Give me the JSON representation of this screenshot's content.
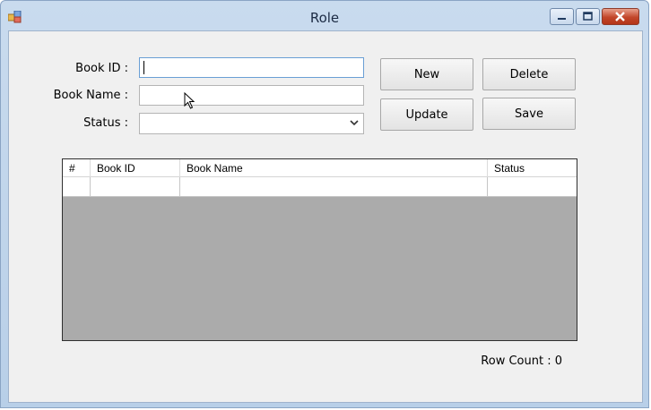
{
  "window": {
    "title": "Role"
  },
  "form": {
    "book_id_label": "Book ID :",
    "book_id_value": "",
    "book_name_label": "Book Name :",
    "book_name_value": "",
    "status_label": "Status :",
    "status_value": ""
  },
  "buttons": {
    "new": "New",
    "delete": "Delete",
    "update": "Update",
    "save": "Save"
  },
  "grid": {
    "columns": [
      "#",
      "Book ID",
      "Book Name",
      "Status"
    ],
    "rows": [
      [
        "",
        "",
        "",
        ""
      ]
    ]
  },
  "footer": {
    "row_count": "Row Count : 0"
  },
  "colors": {
    "grid_background": "#ababab",
    "close_button": "#c2462a"
  }
}
